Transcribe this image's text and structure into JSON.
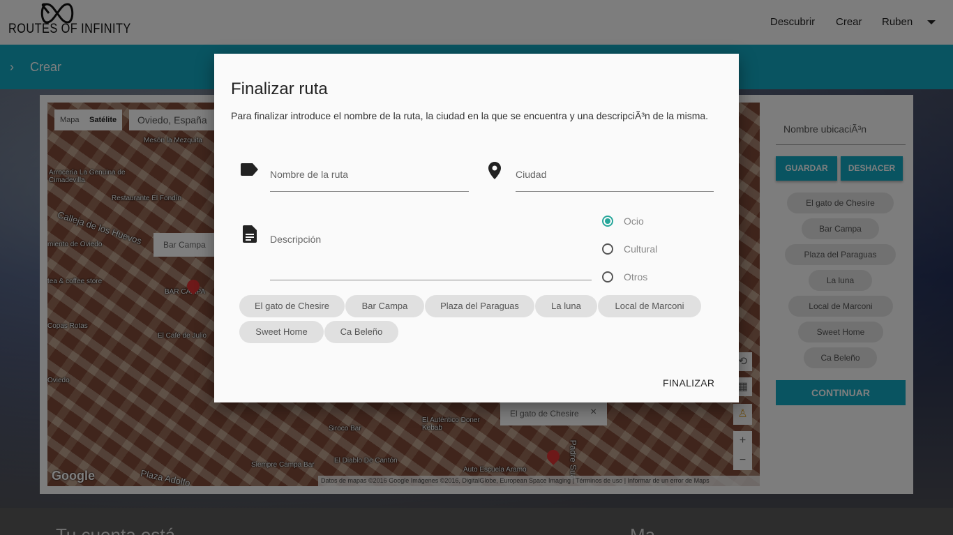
{
  "header": {
    "logo_text": "ROUTES OF INFINITY",
    "nav": [
      "Descubrir",
      "Crear",
      "Ruben"
    ]
  },
  "breadcrumb": {
    "label": "Crear"
  },
  "map": {
    "tab_map": "Mapa",
    "tab_satellite": "Satélite",
    "search_value": "Oviedo, España",
    "labels": [
      "Mesón la Mezquita",
      "Arrocería La Genuina de Cimadevilla",
      "Restaurante El Fondín",
      "Calleja de los Huevos",
      "miento de Oviedo",
      "tea & coffee store",
      "BAR CAMPA",
      "Copas Rotas",
      "El Café de Julio",
      "Oviedo",
      "Siroco Bar",
      "El Auténtico Doner Kebab",
      "Siempre Campa Bar",
      "El Diablo De Cantón",
      "Auto Escuela Aramo",
      "Plaza Adolfo",
      "Padre Suá"
    ],
    "info_bar_campa": "Bar Campa",
    "info_gato": "El gato de Chesire",
    "google": "Google",
    "attribution": "Datos de mapas ©2016 Google Imágenes ©2016, DigitalGlobe, European Space Imaging  |  Términos de uso  |  Informar de un error de Maps"
  },
  "sidebar": {
    "location_placeholder": "Nombre ubicaciÃ³n",
    "save_label": "GUARDAR",
    "undo_label": "DESHACER",
    "chips": [
      "El gato de Chesire",
      "Bar Campa",
      "Plaza del Paraguas",
      "La luna",
      "Local de Marconi",
      "Sweet Home",
      "Ca Beleño"
    ],
    "continue_label": "CONTINUAR"
  },
  "footer": {
    "left": "Tu cuenta está...",
    "right": "Ma..."
  },
  "modal": {
    "title": "Finalizar ruta",
    "description": "Para finalizar introduce el nombre de la ruta, la ciudad en la que se encuentra y una descripciÃ³n de la misma.",
    "route_name_placeholder": "Nombre de la ruta",
    "city_placeholder": "Ciudad",
    "desc_placeholder": "Descripción",
    "categories": [
      "Ocio",
      "Cultural",
      "Otros"
    ],
    "selected_category": "Ocio",
    "chips": [
      "El gato de Chesire",
      "Bar Campa",
      "Plaza del Paraguas",
      "La luna",
      "Local de Marconi",
      "Sweet Home",
      "Ca Beleño"
    ],
    "finish_label": "FINALIZAR"
  },
  "colors": {
    "accent": "#12a9c3",
    "radio": "#26a69a"
  }
}
